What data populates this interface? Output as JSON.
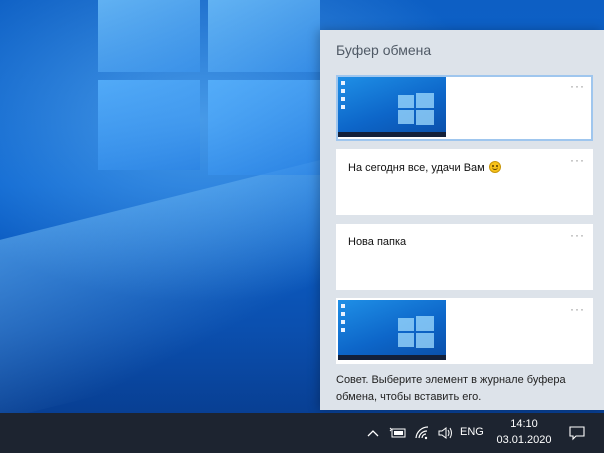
{
  "panel": {
    "title": "Буфер обмена",
    "items": [
      {
        "kind": "image",
        "more": "···"
      },
      {
        "kind": "text",
        "text": "На сегодня все, удачи Вам",
        "emoji": "smiling-face",
        "more": "···"
      },
      {
        "kind": "text",
        "text": "Нова папка",
        "more": "···"
      },
      {
        "kind": "image",
        "more": "···"
      }
    ],
    "tip": "Совет. Выберите элемент в журнале буфера обмена, чтобы вставить его."
  },
  "taskbar": {
    "tray_icons": [
      "chevron-up-icon",
      "battery-icon",
      "wifi-icon",
      "volume-icon"
    ],
    "language": "ENG",
    "time": "14:10",
    "date": "03.01.2020",
    "notification_icon": "action-center-icon"
  },
  "colors": {
    "panel_bg": "#dde3ea",
    "selected_outline": "#9fc6ee",
    "taskbar_bg": "#1d2430"
  }
}
